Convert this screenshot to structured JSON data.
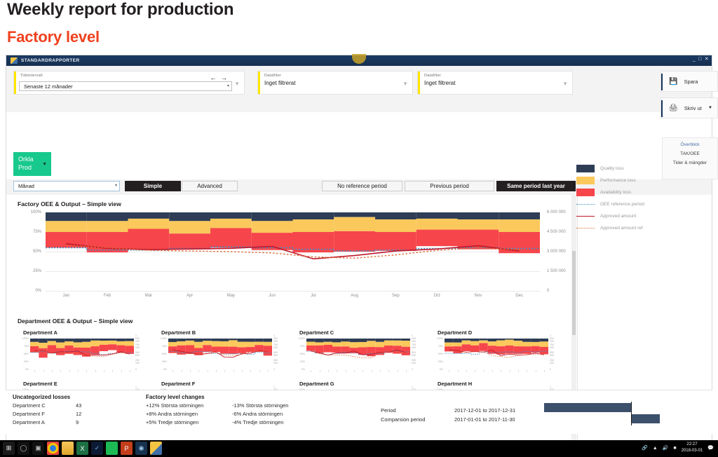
{
  "slide": {
    "title": "Weekly report for production",
    "subtitle": "Factory level",
    "accent_color": "#f0411f"
  },
  "window": {
    "app_title": "STANDARDRAPPORTER",
    "minimize": "_",
    "maximize": "□",
    "close": "✕"
  },
  "filters": {
    "time": {
      "label": "Tidsintervall",
      "value": "Senaste 12 månader",
      "prev_arrow": "←",
      "next_arrow": "→"
    },
    "data1": {
      "label": "Datafilter",
      "value": "Inget filtrerat"
    },
    "data2": {
      "label": "Datafilter",
      "value": "Inget filtrerat"
    }
  },
  "actions": {
    "save": "Spara",
    "print": "Skriv ut"
  },
  "brand": {
    "line1": "Orkla",
    "line2": "Prod"
  },
  "controls": {
    "granularity": "Månad",
    "view_modes": [
      {
        "label": "Simple",
        "active": true
      },
      {
        "label": "Advanced",
        "active": false
      }
    ],
    "reference_periods": [
      {
        "label": "No reference period",
        "active": false
      },
      {
        "label": "Previous period",
        "active": false
      },
      {
        "label": "Same period last year",
        "active": true
      }
    ]
  },
  "right_nav": {
    "items": [
      "Överblick",
      "TAK/OEE",
      "Tider & mängder"
    ],
    "active": "Överblick"
  },
  "sections": {
    "factory_chart_title": "Factory OEE & Output – Simple view",
    "department_chart_title": "Department OEE & Output – Simple view"
  },
  "legend": [
    {
      "label": "Quality loss",
      "type": "swatch",
      "color": "#2e3d55"
    },
    {
      "label": "Performance loss",
      "type": "swatch",
      "color": "#fbc85c"
    },
    {
      "label": "Availability loss",
      "type": "swatch",
      "color": "#f6464b"
    },
    {
      "label": "OEE reference period",
      "type": "dotted",
      "color": "#3d8fc9"
    },
    {
      "label": "Approved amount",
      "type": "solid",
      "color": "#c0172a"
    },
    {
      "label": "Approved amount ref",
      "type": "dotted",
      "color": "#e06a35"
    }
  ],
  "chart_data": {
    "type": "bar",
    "title": "Factory OEE & Output – Simple view",
    "xlabel": "",
    "ylabel": "",
    "categories": [
      "Jan",
      "Feb",
      "Mar",
      "Apr",
      "May",
      "Jun",
      "Jul",
      "Aug",
      "Sep",
      "Oct",
      "Nov",
      "Dec"
    ],
    "y_left_ticks": [
      "0%",
      "25%",
      "50%",
      "75%",
      "100%"
    ],
    "y_left_range": [
      0,
      100
    ],
    "y_right_ticks": [
      "0",
      "1 500 000",
      "3 000 000",
      "4 500 000",
      "6 000 000"
    ],
    "y_right_range": [
      0,
      6000000
    ],
    "grid": true,
    "legend_position": "right",
    "series": [
      {
        "name": "Quality loss",
        "color": "#2e3d55",
        "stacked": true,
        "values": [
          11,
          11,
          8,
          11,
          8,
          11,
          9,
          6,
          9,
          8,
          9,
          9
        ]
      },
      {
        "name": "Performance loss",
        "color": "#fbc85c",
        "stacked": true,
        "values": [
          14,
          14,
          13,
          16,
          12,
          15,
          16,
          18,
          16,
          14,
          13,
          16
        ]
      },
      {
        "name": "Availability loss",
        "color": "#f6464b",
        "stacked": true,
        "values": [
          20,
          26,
          26,
          20,
          25,
          22,
          26,
          26,
          24,
          21,
          25,
          27
        ]
      },
      {
        "name": "OEE reference period",
        "color": "#3d8fc9",
        "type": "dotted-line",
        "values": [
          55,
          52,
          52,
          54,
          56,
          55,
          53,
          51,
          52,
          54,
          55,
          54
        ]
      },
      {
        "name": "Approved amount",
        "color": "#c0172a",
        "type": "line",
        "values": [
          3600000,
          3250000,
          3150000,
          3200000,
          3250000,
          3400000,
          2450000,
          2700000,
          3050000,
          3200000,
          3450000,
          3050000
        ]
      },
      {
        "name": "Approved amount ref",
        "color": "#e06a35",
        "type": "dotted-line",
        "values": [
          3500000,
          3300000,
          3100000,
          3050000,
          3000000,
          2900000,
          2600000,
          2500000,
          2750000,
          3100000,
          3300000,
          3150000
        ]
      }
    ]
  },
  "departments": [
    {
      "name": "Department A"
    },
    {
      "name": "Department B"
    },
    {
      "name": "Department C"
    },
    {
      "name": "Department D"
    },
    {
      "name": "Department E"
    },
    {
      "name": "Department F"
    },
    {
      "name": "Department G"
    },
    {
      "name": "Department H"
    }
  ],
  "department_axis": {
    "y_left_ticks": [
      "0%",
      "25%",
      "50%",
      "75%",
      "100%"
    ],
    "y_right_ticks": [
      "0",
      "250 000",
      "500 000",
      "750 000",
      "1 000 000"
    ]
  },
  "bottom": {
    "uncategorized": {
      "title": "Uncategorized losses",
      "rows": [
        {
          "name": "Department C",
          "value": "43"
        },
        {
          "name": "Department F",
          "value": "12"
        },
        {
          "name": "Department A",
          "value": "9"
        }
      ]
    },
    "changes": {
      "title": "Factory level changes",
      "rows": [
        {
          "up": "+12% Största störningen",
          "down": "-13% Största störningen"
        },
        {
          "up": "+8% Andra störningen",
          "down": "-6% Andra störningen"
        },
        {
          "up": "+5% Tredje störningen",
          "down": "-4% Tredje störningen"
        }
      ]
    },
    "periods": [
      {
        "label": "Period",
        "value": "2017-12-01 to 2017-12-31"
      },
      {
        "label": "Comparsion period",
        "value": "2017-01-01 to 2017-11-30"
      }
    ]
  },
  "taskbar": {
    "start": "⊞",
    "icons": [
      "cortana-icon",
      "task-view-icon",
      "chrome-icon",
      "explorer-icon",
      "excel-icon",
      "outlook-icon",
      "spotify-icon",
      "powerpoint-icon",
      "skype-icon",
      "app-icon"
    ],
    "clock_time": "22:27",
    "clock_date": "2018-03-01"
  }
}
